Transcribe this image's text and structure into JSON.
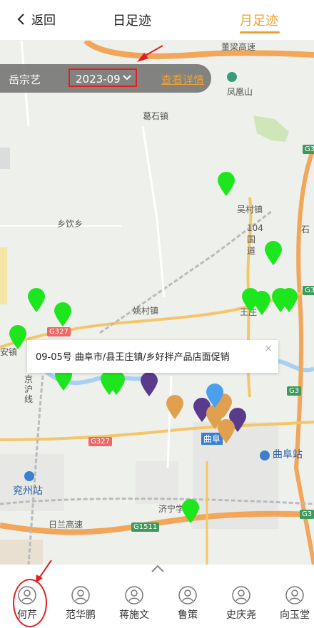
{
  "header": {
    "back_label": "返回",
    "tab_day": "日足迹",
    "tab_month": "月足迹"
  },
  "filter": {
    "person_name": "岳宗艺",
    "month_value": "2023-09",
    "detail_link": "查看详情"
  },
  "map": {
    "labels": {
      "dongliang_expressway": "董梁高速",
      "fenghuangshan": "凤凰山",
      "geshi_town": "葛石镇",
      "wucun_town": "吴村镇",
      "xiangyin_township": "乡饮乡",
      "national_road_104": "104国道",
      "shi_partial": "石",
      "yaocun_town": "姚村镇",
      "wangzhuang_partial": "王庄",
      "an_town_partial": "安镇",
      "jinghu_line": "京沪线",
      "qufu_station": "曲阜站",
      "yanzhou_station": "兖州站",
      "jining_university": "济宁学院",
      "rilan_expressway": "日兰高速",
      "qufu_partial": "曲阜"
    },
    "road_shields": {
      "g3_top": "G3",
      "g3_mid": "G3",
      "g3_lower": "G3",
      "g3_bottom": "G3",
      "g327_left": "G327",
      "g327_mid": "G327",
      "g1511": "G1511"
    },
    "pin_colors": {
      "green": "#1ee61e",
      "purple": "#5a3a8c",
      "orange": "#e0a050",
      "blue": "#4aa0ee"
    }
  },
  "popup": {
    "text": "09-05号  曲阜市/县王庄镇/乡好拌产品店面促销",
    "close_symbol": "×"
  },
  "people": [
    {
      "name": "何芹"
    },
    {
      "name": "范华鹏"
    },
    {
      "name": "蒋施文"
    },
    {
      "name": "鲁策"
    },
    {
      "name": "史庆尧"
    },
    {
      "name": "向玉堂"
    }
  ]
}
